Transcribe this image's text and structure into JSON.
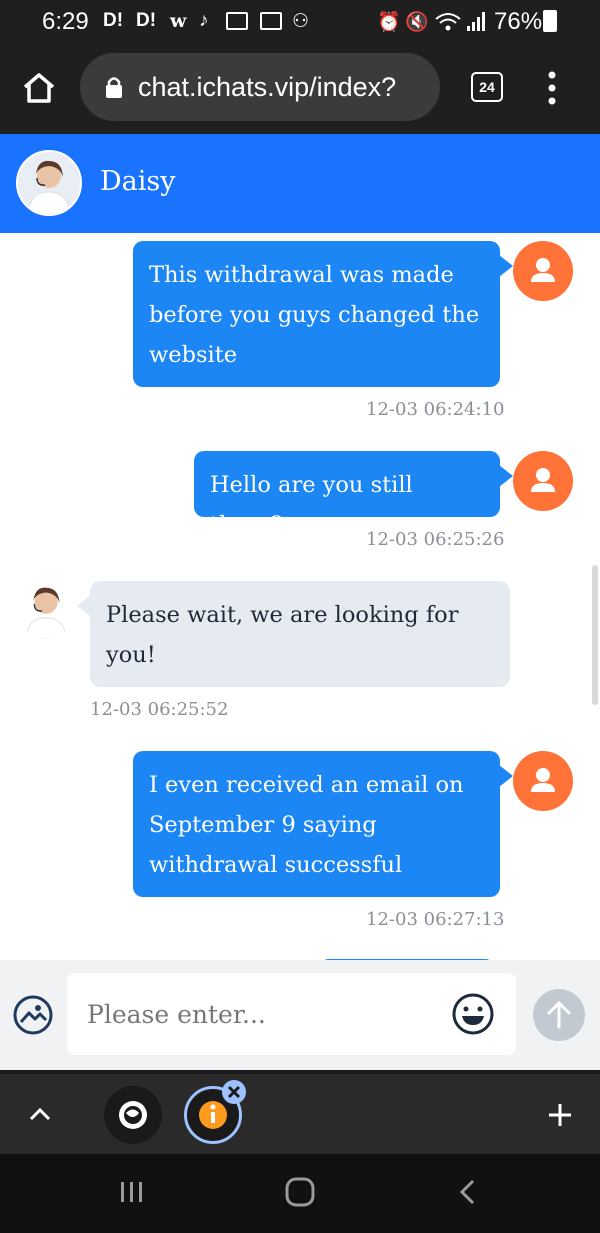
{
  "status_bar": {
    "time": "6:29",
    "notification_icons": [
      "D!",
      "D!"
    ],
    "battery_percent": "76%"
  },
  "browser": {
    "url": "chat.ichats.vip/index?",
    "tab_count": "24"
  },
  "chat_header": {
    "agent_name": "Daisy"
  },
  "messages": [
    {
      "side": "out",
      "text": "This withdrawal was made before you guys changed the website",
      "time": "12-03 06:24:10"
    },
    {
      "side": "out",
      "text": "Hello are you still there?",
      "time": "12-03 06:25:26"
    },
    {
      "side": "in",
      "text": "Please wait, we are looking for you!",
      "time": "12-03 06:25:52"
    },
    {
      "side": "out",
      "text": "I even received an email on September 9 saying withdrawal successful",
      "time": "12-03 06:27:13"
    }
  ],
  "input": {
    "placeholder": "Please enter..."
  },
  "colors": {
    "header_blue": "#1a73ff",
    "outgoing_bubble": "#1d86f5",
    "incoming_bubble": "#e6ebf2",
    "user_avatar": "#ff7338"
  }
}
